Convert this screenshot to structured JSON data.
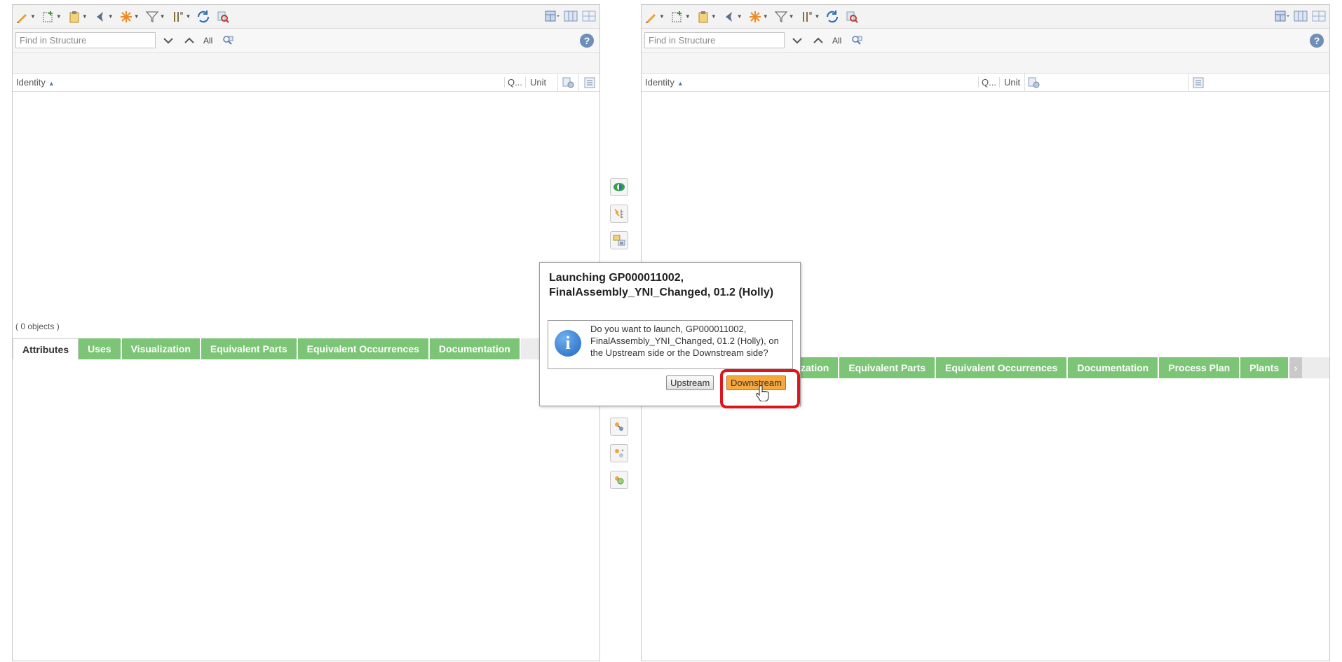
{
  "left_panel": {
    "search_placeholder": "Find in Structure",
    "find_all_label": "All",
    "help_label": "?",
    "columns": {
      "identity": "Identity",
      "quantity": "Q...",
      "unit": "Unit"
    },
    "status_text": "( 0 objects )",
    "tabs": [
      "Attributes",
      "Uses",
      "Visualization",
      "Equivalent Parts",
      "Equivalent Occurrences",
      "Documentation"
    ]
  },
  "right_panel": {
    "search_placeholder": "Find in Structure",
    "find_all_label": "All",
    "help_label": "?",
    "columns": {
      "identity": "Identity",
      "quantity": "Q...",
      "unit": "Unit"
    },
    "tabs": [
      "ization",
      "Equivalent Parts",
      "Equivalent Occurrences",
      "Documentation",
      "Process Plan",
      "Plants"
    ],
    "tabs_next": "›"
  },
  "dialog": {
    "title": "Launching GP000011002, FinalAssembly_YNI_Changed, 01.2 (Holly)",
    "message": "Do you want to launch, GP000011002, FinalAssembly_YNI_Changed, 01.2 (Holly), on the Upstream side or the Downstream side?",
    "info_icon_glyph": "i",
    "upstream_label": "Upstream",
    "downstream_label": "Downstream"
  },
  "colors": {
    "tab_green": "#7cc576",
    "downstream_orange": "#f6a83c",
    "highlight_red": "#e0141b"
  },
  "icons": {
    "toolbar": [
      "edit-icon",
      "insert-icon",
      "clipboard-icon",
      "navigate-icon",
      "create-icon",
      "filter-icon",
      "tools-icon",
      "refresh-icon",
      "inspect-icon"
    ],
    "middle_strip": [
      "compare-icon",
      "align-icon",
      "transfer-icon",
      "copy-structure-icon",
      "link-icon",
      "unlink-icon",
      "sync-icon"
    ]
  }
}
